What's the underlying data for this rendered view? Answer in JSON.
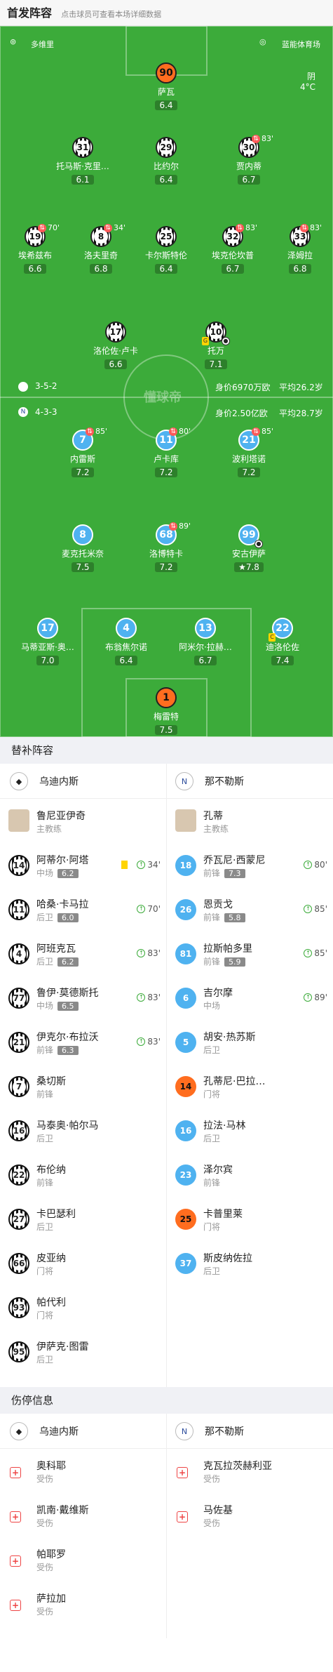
{
  "header": {
    "title": "首发阵容",
    "subtitle": "点击球员可查看本场详细数据"
  },
  "pitch": {
    "ref_label": "多维里",
    "stadium": "蓝能体育场",
    "weather": "阴",
    "temp": "4°C",
    "watermark": "懂球帝",
    "home_formation": "3-5-2",
    "home_value": "身价6970万欧",
    "home_age": "平均26.2岁",
    "away_formation": "4-3-3",
    "away_value": "身价2.50亿欧",
    "away_age": "平均28.7岁",
    "colors": {
      "pitch": "#3cab3a",
      "home": "#111111",
      "away": "#4fb2f0",
      "keeper": "#ff6d1f"
    }
  },
  "home_players": [
    {
      "num": "90",
      "name": "萨瓦",
      "rating": "6.4",
      "kit": "orange",
      "sub": ""
    },
    {
      "num": "31",
      "name": "托马斯·克里…",
      "rating": "6.1",
      "kit": "strip",
      "sub": ""
    },
    {
      "num": "29",
      "name": "比约尔",
      "rating": "6.4",
      "kit": "strip",
      "sub": ""
    },
    {
      "num": "30",
      "name": "贾内蒂",
      "rating": "6.7",
      "kit": "strip",
      "sub": "83'"
    },
    {
      "num": "19",
      "name": "埃希兹布",
      "rating": "6.6",
      "kit": "strip",
      "sub": "70'"
    },
    {
      "num": "8",
      "name": "洛夫里奇",
      "rating": "6.8",
      "kit": "strip",
      "sub": "34'"
    },
    {
      "num": "25",
      "name": "卡尔斯特伦",
      "rating": "6.4",
      "kit": "strip",
      "sub": ""
    },
    {
      "num": "32",
      "name": "埃克伦坎普",
      "rating": "6.7",
      "kit": "strip",
      "sub": "83'"
    },
    {
      "num": "33",
      "name": "泽姆拉",
      "rating": "6.8",
      "kit": "strip",
      "sub": "83'"
    },
    {
      "num": "17",
      "name": "洛伦佐·卢卡",
      "rating": "6.6",
      "kit": "strip",
      "sub": ""
    },
    {
      "num": "10",
      "name": "托万",
      "rating": "7.1",
      "kit": "strip",
      "sub": ""
    }
  ],
  "away_players": [
    {
      "num": "7",
      "name": "内雷斯",
      "rating": "7.2",
      "sub": "85'"
    },
    {
      "num": "11",
      "name": "卢卡库",
      "rating": "7.2",
      "sub": "80'"
    },
    {
      "num": "21",
      "name": "波利塔诺",
      "rating": "7.2",
      "sub": "85'"
    },
    {
      "num": "8",
      "name": "麦克托米奈",
      "rating": "7.5",
      "sub": ""
    },
    {
      "num": "68",
      "name": "洛博特卡",
      "rating": "7.2",
      "sub": "89'"
    },
    {
      "num": "99",
      "name": "安古伊萨",
      "rating": "7.8",
      "sub": ""
    },
    {
      "num": "17",
      "name": "马蒂亚斯·奥…",
      "rating": "7.0",
      "sub": ""
    },
    {
      "num": "4",
      "name": "布翁焦尔诺",
      "rating": "6.4",
      "sub": ""
    },
    {
      "num": "13",
      "name": "阿米尔·拉赫…",
      "rating": "6.7",
      "sub": ""
    },
    {
      "num": "22",
      "name": "迪洛伦佐",
      "rating": "7.4",
      "sub": ""
    },
    {
      "num": "1",
      "name": "梅雷特",
      "rating": "7.5",
      "sub": ""
    }
  ],
  "subs_section": {
    "title": "替补阵容",
    "home_team": "乌迪内斯",
    "away_team": "那不勒斯",
    "home_coach": "鲁尼亚伊奇",
    "away_coach": "孔蒂",
    "coach_role": "主教练"
  },
  "home_subs": [
    {
      "num": "14",
      "name": "阿蒂尔·阿塔",
      "pos": "中场",
      "rating": "6.2",
      "time": "34'",
      "card": true
    },
    {
      "num": "11",
      "name": "哈桑·卡马拉",
      "pos": "后卫",
      "rating": "6.0",
      "time": "70'",
      "card": false
    },
    {
      "num": "4",
      "name": "阿班克瓦",
      "pos": "后卫",
      "rating": "6.2",
      "time": "83'",
      "card": false
    },
    {
      "num": "77",
      "name": "鲁伊·莫德斯托",
      "pos": "中场",
      "rating": "6.5",
      "time": "83'",
      "card": false
    },
    {
      "num": "21",
      "name": "伊克尔·布拉沃",
      "pos": "前锋",
      "rating": "6.3",
      "time": "83'",
      "card": false
    },
    {
      "num": "7",
      "name": "桑切斯",
      "pos": "前锋",
      "rating": "",
      "time": "",
      "card": false
    },
    {
      "num": "16",
      "name": "马泰奥·帕尔马",
      "pos": "后卫",
      "rating": "",
      "time": "",
      "card": false
    },
    {
      "num": "22",
      "name": "布伦纳",
      "pos": "前锋",
      "rating": "",
      "time": "",
      "card": false
    },
    {
      "num": "27",
      "name": "卡巴瑟利",
      "pos": "后卫",
      "rating": "",
      "time": "",
      "card": false
    },
    {
      "num": "66",
      "name": "皮亚纳",
      "pos": "门将",
      "rating": "",
      "time": "",
      "card": false
    },
    {
      "num": "93",
      "name": "帕代利",
      "pos": "门将",
      "rating": "",
      "time": "",
      "card": false
    },
    {
      "num": "95",
      "name": "伊萨克·图雷",
      "pos": "后卫",
      "rating": "",
      "time": "",
      "card": false
    }
  ],
  "away_subs": [
    {
      "num": "18",
      "name": "乔瓦尼·西蒙尼",
      "pos": "前锋",
      "rating": "7.3",
      "time": "80'",
      "kit": "blue"
    },
    {
      "num": "26",
      "name": "恩贡戈",
      "pos": "前锋",
      "rating": "5.8",
      "time": "85'",
      "kit": "blue"
    },
    {
      "num": "81",
      "name": "拉斯帕多里",
      "pos": "前锋",
      "rating": "5.9",
      "time": "85'",
      "kit": "blue"
    },
    {
      "num": "6",
      "name": "吉尔摩",
      "pos": "中场",
      "rating": "",
      "time": "89'",
      "kit": "blue"
    },
    {
      "num": "5",
      "name": "胡安·热苏斯",
      "pos": "后卫",
      "rating": "",
      "time": "",
      "kit": "blue"
    },
    {
      "num": "14",
      "name": "孔蒂尼·巴拉…",
      "pos": "门将",
      "rating": "",
      "time": "",
      "kit": "orange"
    },
    {
      "num": "16",
      "name": "拉法·马林",
      "pos": "后卫",
      "rating": "",
      "time": "",
      "kit": "blue"
    },
    {
      "num": "23",
      "name": "泽尔宾",
      "pos": "前锋",
      "rating": "",
      "time": "",
      "kit": "blue"
    },
    {
      "num": "25",
      "name": "卡普里莱",
      "pos": "门将",
      "rating": "",
      "time": "",
      "kit": "orange"
    },
    {
      "num": "37",
      "name": "斯皮纳佐拉",
      "pos": "后卫",
      "rating": "",
      "time": "",
      "kit": "blue"
    }
  ],
  "injury_section": {
    "title": "伤停信息",
    "home_team": "乌迪内斯",
    "away_team": "那不勒斯"
  },
  "home_injuries": [
    {
      "name": "奥科耶",
      "status": "受伤"
    },
    {
      "name": "凯南·戴维斯",
      "status": "受伤"
    },
    {
      "name": "帕耶罗",
      "status": "受伤"
    },
    {
      "name": "萨拉加",
      "status": "受伤"
    }
  ],
  "away_injuries": [
    {
      "name": "克瓦拉茨赫利亚",
      "status": "受伤"
    },
    {
      "name": "马佐基",
      "status": "受伤"
    }
  ]
}
